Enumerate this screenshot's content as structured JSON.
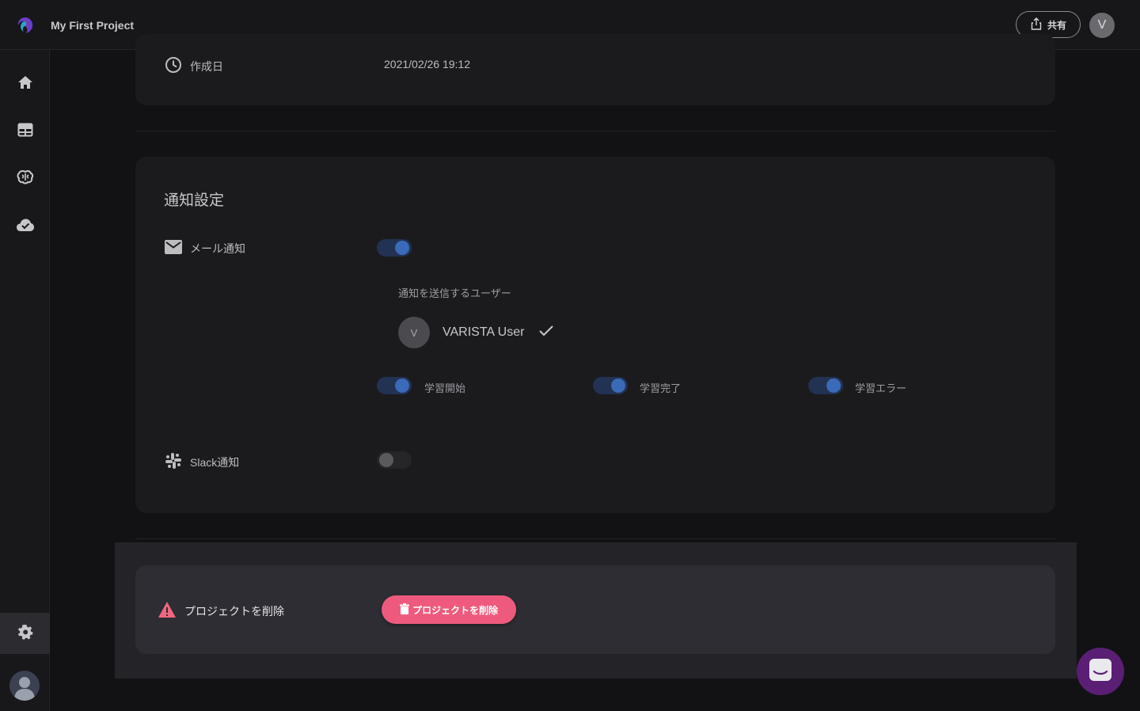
{
  "header": {
    "project_title": "My First Project",
    "share_label": "共有",
    "avatar_initial": "V"
  },
  "sidebar": {
    "items": [
      {
        "icon": "home-icon"
      },
      {
        "icon": "table-icon"
      },
      {
        "icon": "brain-icon"
      },
      {
        "icon": "cloud-check-icon"
      },
      {
        "icon": "gear-icon",
        "active": true
      }
    ]
  },
  "info_card": {
    "created_label": "作成日",
    "created_value": "2021/02/26 19:12"
  },
  "notifications": {
    "title": "通知設定",
    "mail_label": "メール通知",
    "mail_enabled": true,
    "recipients_heading": "通知を送信するユーザー",
    "recipient": {
      "initial": "V",
      "name": "VARISTA User",
      "selected": true
    },
    "events": [
      {
        "label": "学習開始",
        "enabled": true
      },
      {
        "label": "学習完了",
        "enabled": true
      },
      {
        "label": "学習エラー",
        "enabled": true
      }
    ],
    "slack_label": "Slack通知",
    "slack_enabled": false
  },
  "danger": {
    "label": "プロジェクトを削除",
    "button_label": "プロジェクトを削除"
  },
  "colors": {
    "accent": "#3b6ab8",
    "danger": "#ee5a7d",
    "warning": "#f06680",
    "chat": "#5a1f74"
  }
}
